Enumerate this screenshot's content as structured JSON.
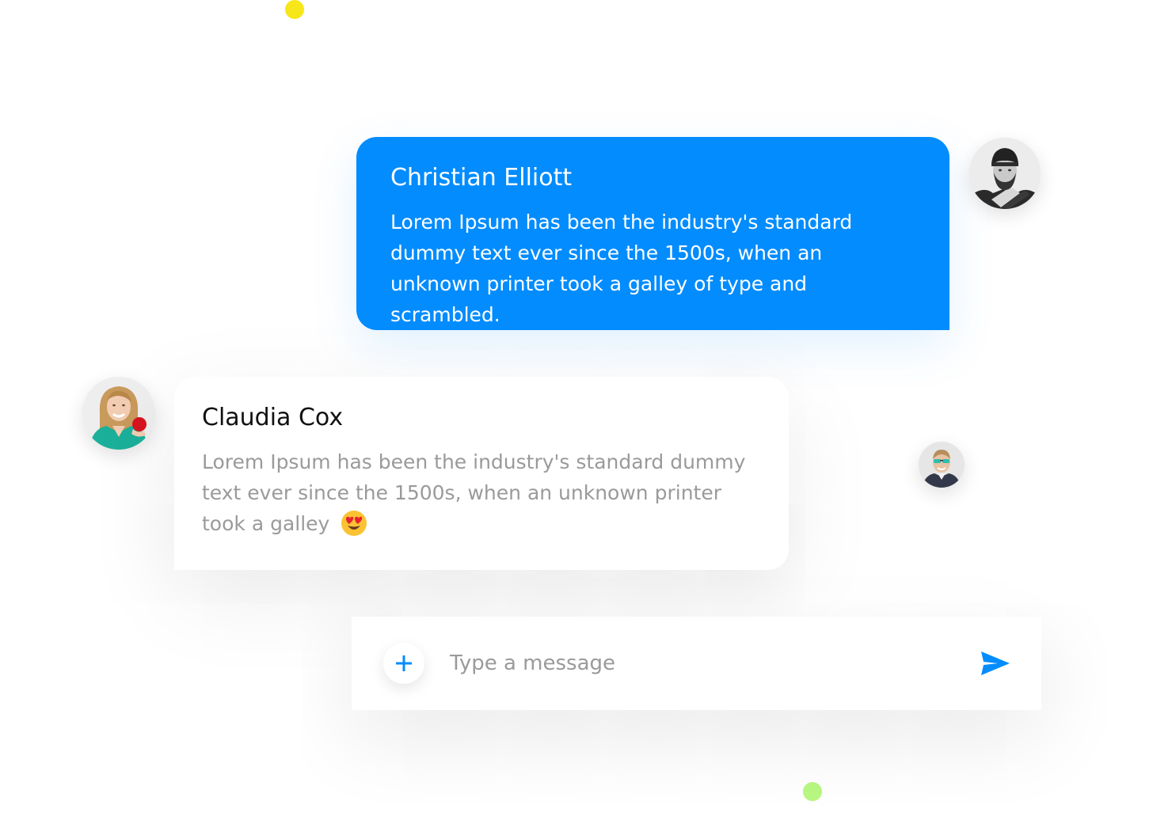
{
  "colors": {
    "accent": "#028cfe",
    "dot_yellow": "#f7e61a",
    "dot_green": "#b8f780",
    "text_muted": "#9a9a9a"
  },
  "messages": [
    {
      "sender": "Christian Elliott",
      "text": "Lorem Ipsum has been the industry's standard dummy text ever since the 1500s, when an unknown printer took a galley of type and scrambled.",
      "avatar": "avatar-christian"
    },
    {
      "sender": "Claudia Cox",
      "text": "Lorem Ipsum has been the industry's standard dummy text ever since the 1500s, when an unknown printer took a galley",
      "emoji": "heart-eyes-emoji",
      "avatar": "avatar-claudia"
    }
  ],
  "composer": {
    "placeholder": "Type a message",
    "add_icon": "plus-icon",
    "send_icon": "send-icon"
  }
}
